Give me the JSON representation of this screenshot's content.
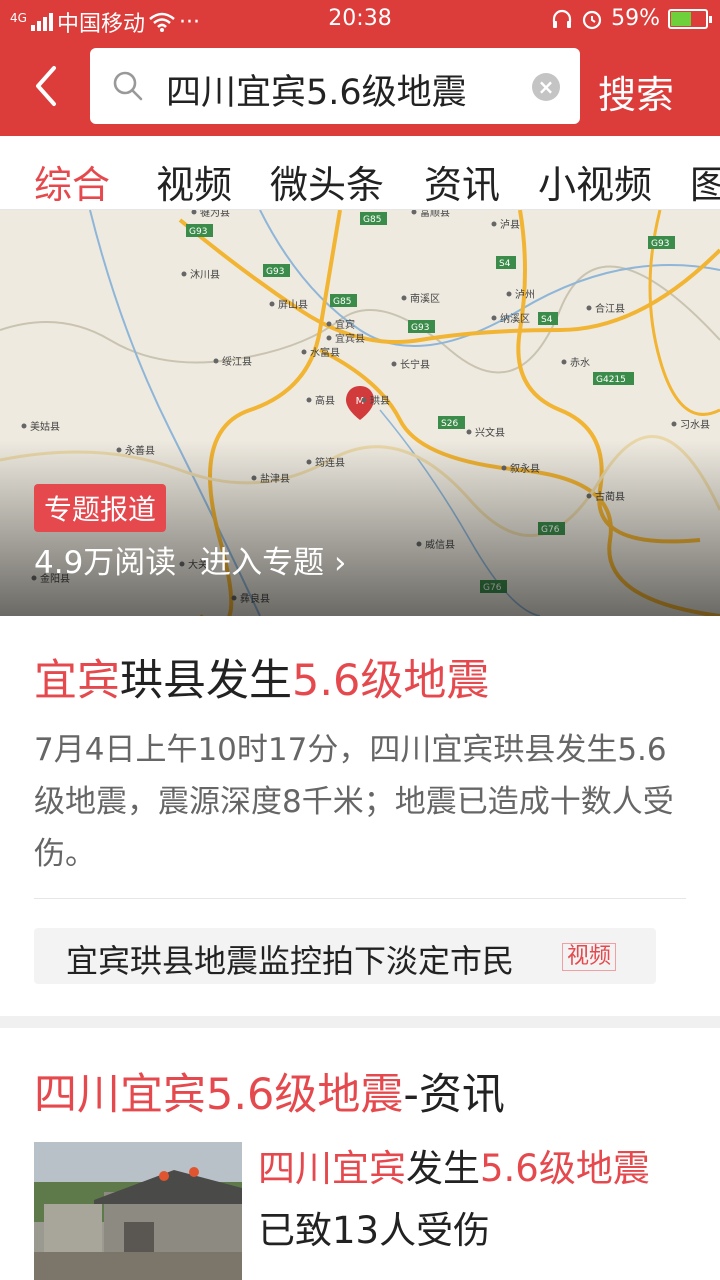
{
  "status_bar": {
    "carrier": "中国移动",
    "network": "4G",
    "time": "20:38",
    "battery": "59%",
    "battery_level": 0.59,
    "more": "···"
  },
  "header": {
    "search_query": "四川宜宾5.6级地震",
    "search_button": "搜索",
    "back_icon": "chevron-left-icon",
    "clear_icon": "clear-icon"
  },
  "tabs": [
    {
      "label": "综合",
      "active": true
    },
    {
      "label": "视频"
    },
    {
      "label": "微头条"
    },
    {
      "label": "资讯"
    },
    {
      "label": "小视频"
    },
    {
      "label": "图"
    }
  ],
  "map_card": {
    "badge": "专题报道",
    "reads": "4.9万阅读",
    "enter": "进入专题 ›",
    "marker_label": "M",
    "places": [
      "犍为县",
      "富顺县",
      "泸县",
      "沐川县",
      "泸州",
      "合江县",
      "屏山县",
      "宜宾",
      "南溪区",
      "宜宾县",
      "纳溪区",
      "绥江县",
      "水富县",
      "长宁县",
      "赤水",
      "高县",
      "珙县",
      "美姑县",
      "永善县",
      "兴文县",
      "习水县",
      "筠连县",
      "叙永县",
      "盐津县",
      "古蔺县",
      "威信县",
      "金阳县",
      "大关",
      "彝良县"
    ],
    "roads": [
      "G85",
      "G93",
      "G93",
      "S4",
      "G93",
      "G85",
      "G93",
      "S4",
      "G4215",
      "S26",
      "G76",
      "G76"
    ]
  },
  "article": {
    "title_parts": [
      {
        "text": "宜宾",
        "red": true
      },
      {
        "text": "珙县发生",
        "red": false
      },
      {
        "text": "5.6级地震",
        "red": true
      }
    ],
    "summary": "7月4日上午10时17分，四川宜宾珙县发生5.6级地震，震源深度8千米；地震已造成十数人受伤。",
    "related_title": "宜宾珙县地震监控拍下淡定市民",
    "related_tag": "视频"
  },
  "section2": {
    "title_parts": [
      {
        "text": "四川宜宾5.6级地震",
        "red": true
      },
      {
        "text": "-资讯",
        "red": false
      }
    ],
    "news_title_parts": [
      {
        "text": "四川宜宾",
        "red": true
      },
      {
        "text": "发生",
        "red": false
      },
      {
        "text": "5.6级地震",
        "red": true
      },
      {
        "text": "已致13人受伤",
        "red": false
      }
    ]
  },
  "colors": {
    "brand": "#dc3d3b",
    "highlight": "#e5494d"
  }
}
